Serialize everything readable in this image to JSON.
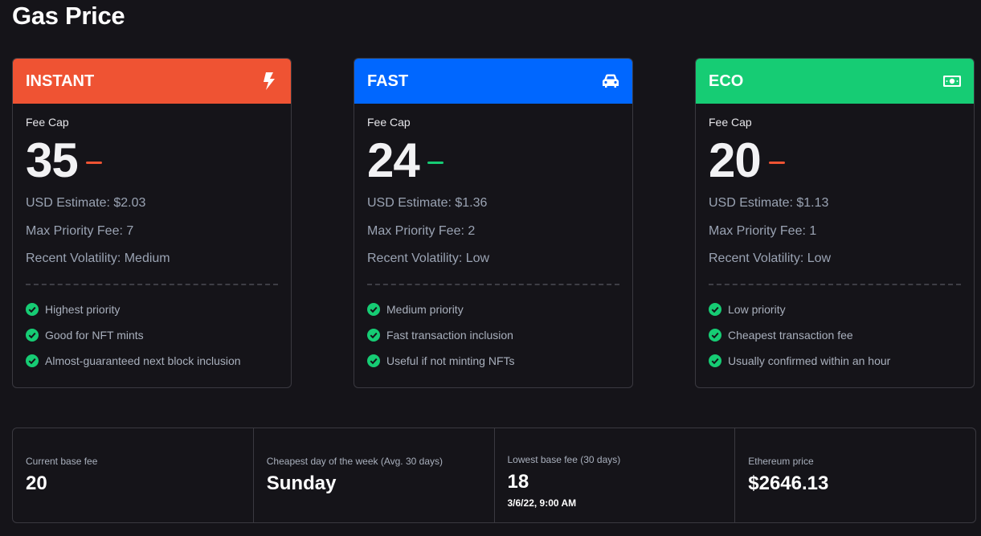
{
  "page": {
    "title": "Gas Price"
  },
  "cards": [
    {
      "name": "INSTANT",
      "icon": "lightning-bolt-icon",
      "header_color": "#ef5333",
      "fee_cap_label": "Fee Cap",
      "fee_cap": "35",
      "trend_color": "#ef5333",
      "usd_estimate": "USD Estimate: $2.03",
      "max_priority_fee": "Max Priority Fee: 7",
      "volatility": "Recent Volatility: Medium",
      "features": [
        "Highest priority",
        "Good for NFT mints",
        "Almost-guaranteed next block inclusion"
      ]
    },
    {
      "name": "FAST",
      "icon": "car-icon",
      "header_color": "#0067ff",
      "fee_cap_label": "Fee Cap",
      "fee_cap": "24",
      "trend_color": "#16cc74",
      "usd_estimate": "USD Estimate: $1.36",
      "max_priority_fee": "Max Priority Fee: 2",
      "volatility": "Recent Volatility: Low",
      "features": [
        "Medium priority",
        "Fast transaction inclusion",
        "Useful if not minting NFTs"
      ]
    },
    {
      "name": "ECO",
      "icon": "money-bill-icon",
      "header_color": "#16cc74",
      "fee_cap_label": "Fee Cap",
      "fee_cap": "20",
      "trend_color": "#ef5333",
      "usd_estimate": "USD Estimate: $1.13",
      "max_priority_fee": "Max Priority Fee: 1",
      "volatility": "Recent Volatility: Low",
      "features": [
        "Low priority",
        "Cheapest transaction fee",
        "Usually confirmed within an hour"
      ]
    }
  ],
  "check_icon": "check-circle-icon",
  "check_color": "#16cc74",
  "stats": {
    "current_base_fee": {
      "label": "Current base fee",
      "value": "20"
    },
    "cheapest_day": {
      "label": "Cheapest day of the week (Avg. 30 days)",
      "value": "Sunday"
    },
    "lowest_base_fee": {
      "label": "Lowest base fee (30 days)",
      "value": "18",
      "sub": "3/6/22, 9:00 AM"
    },
    "eth_price": {
      "label": "Ethereum price",
      "value": "$2646.13"
    }
  }
}
